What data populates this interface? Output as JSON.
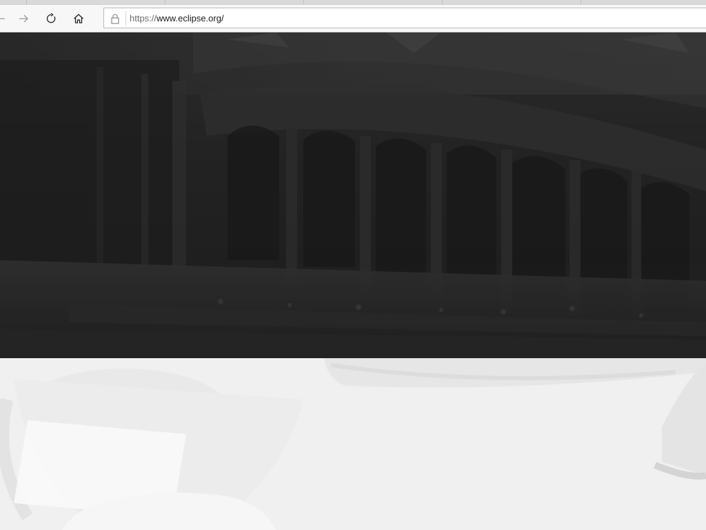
{
  "browser": {
    "url_scheme": "https://",
    "url_host": "www.eclipse.org/",
    "icons": {
      "back": "back-arrow-icon",
      "forward": "forward-arrow-icon",
      "refresh": "refresh-icon",
      "home": "home-icon",
      "lock": "lock-icon"
    }
  },
  "colors": {
    "hero_background": "#222222",
    "page_background": "#f1f1f1",
    "toolbar_background": "#f7f7f7"
  }
}
